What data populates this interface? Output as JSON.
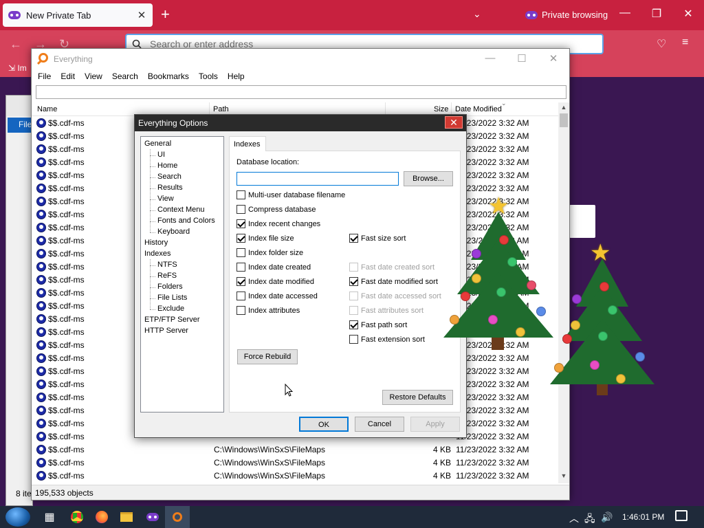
{
  "browser": {
    "tab_title": "New Private Tab",
    "tab_close": "✕",
    "new_tab": "+",
    "tab_list": "⌄",
    "private_label": "Private browsing",
    "url_placeholder": "Search or enter address",
    "import_label": "Im"
  },
  "bg_window": {
    "file_tab": "File",
    "status_text": "8 ite"
  },
  "everything": {
    "title": "Everything",
    "menu": [
      "File",
      "Edit",
      "View",
      "Search",
      "Bookmarks",
      "Tools",
      "Help"
    ],
    "columns": {
      "name": "Name",
      "path": "Path",
      "size": "Size",
      "date": "Date Modified"
    },
    "rows": [
      {
        "name": "$$.cdf-ms",
        "path": "",
        "size": "",
        "date": "11/23/2022 3:32 AM"
      },
      {
        "name": "$$.cdf-ms",
        "path": "",
        "size": "",
        "date": "11/23/2022 3:32 AM"
      },
      {
        "name": "$$.cdf-ms",
        "path": "",
        "size": "",
        "date": "11/23/2022 3:32 AM"
      },
      {
        "name": "$$.cdf-ms",
        "path": "",
        "size": "",
        "date": "11/23/2022 3:32 AM"
      },
      {
        "name": "$$.cdf-ms",
        "path": "",
        "size": "",
        "date": "11/23/2022 3:32 AM"
      },
      {
        "name": "$$.cdf-ms",
        "path": "",
        "size": "",
        "date": "11/23/2022 3:32 AM"
      },
      {
        "name": "$$.cdf-ms",
        "path": "",
        "size": "",
        "date": "11/23/2022 3:32 AM"
      },
      {
        "name": "$$.cdf-ms",
        "path": "",
        "size": "",
        "date": "11/23/2022 3:32 AM"
      },
      {
        "name": "$$.cdf-ms",
        "path": "",
        "size": "",
        "date": "11/23/2022 3:32 AM"
      },
      {
        "name": "$$.cdf-ms",
        "path": "",
        "size": "",
        "date": "11/23/2022 3:32 AM"
      },
      {
        "name": "$$.cdf-ms",
        "path": "",
        "size": "",
        "date": "11/23/2022 3:32 AM"
      },
      {
        "name": "$$.cdf-ms",
        "path": "",
        "size": "",
        "date": "11/23/2022 3:32 AM"
      },
      {
        "name": "$$.cdf-ms",
        "path": "",
        "size": "",
        "date": "11/23/2022 3:32 AM"
      },
      {
        "name": "$$.cdf-ms",
        "path": "",
        "size": "",
        "date": "11/23/2022 3:32 AM"
      },
      {
        "name": "$$.cdf-ms",
        "path": "",
        "size": "",
        "date": "11/23/2022 3:32 AM"
      },
      {
        "name": "$$.cdf-ms",
        "path": "",
        "size": "",
        "date": "11/23/2022 3:32 AM"
      },
      {
        "name": "$$.cdf-ms",
        "path": "",
        "size": "",
        "date": "11/23/2022 3:32 AM"
      },
      {
        "name": "$$.cdf-ms",
        "path": "",
        "size": "",
        "date": "11/23/2022 3:32 AM"
      },
      {
        "name": "$$.cdf-ms",
        "path": "",
        "size": "",
        "date": "11/23/2022 3:32 AM"
      },
      {
        "name": "$$.cdf-ms",
        "path": "",
        "size": "",
        "date": "11/23/2022 3:32 AM"
      },
      {
        "name": "$$.cdf-ms",
        "path": "",
        "size": "",
        "date": "11/23/2022 3:32 AM"
      },
      {
        "name": "$$.cdf-ms",
        "path": "",
        "size": "",
        "date": "11/23/2022 3:32 AM"
      },
      {
        "name": "$$.cdf-ms",
        "path": "",
        "size": "",
        "date": "11/23/2022 3:32 AM"
      },
      {
        "name": "$$.cdf-ms",
        "path": "",
        "size": "",
        "date": "11/23/2022 3:32 AM"
      },
      {
        "name": "$$.cdf-ms",
        "path": "",
        "size": "",
        "date": "11/23/2022 3:32 AM"
      },
      {
        "name": "$$.cdf-ms",
        "path": "C:\\Windows\\WinSxS\\FileMaps",
        "size": "4 KB",
        "date": "11/23/2022 3:32 AM"
      },
      {
        "name": "$$.cdf-ms",
        "path": "C:\\Windows\\WinSxS\\FileMaps",
        "size": "4 KB",
        "date": "11/23/2022 3:32 AM"
      },
      {
        "name": "$$.cdf-ms",
        "path": "C:\\Windows\\WinSxS\\FileMaps",
        "size": "4 KB",
        "date": "11/23/2022 3:32 AM"
      }
    ],
    "status": "195,533 objects"
  },
  "options": {
    "title": "Everything Options",
    "close": "✕",
    "tree": [
      {
        "label": "General",
        "level": 0
      },
      {
        "label": "UI",
        "level": 1
      },
      {
        "label": "Home",
        "level": 1
      },
      {
        "label": "Search",
        "level": 1
      },
      {
        "label": "Results",
        "level": 1
      },
      {
        "label": "View",
        "level": 1
      },
      {
        "label": "Context Menu",
        "level": 1
      },
      {
        "label": "Fonts and Colors",
        "level": 1
      },
      {
        "label": "Keyboard",
        "level": 1
      },
      {
        "label": "History",
        "level": 0
      },
      {
        "label": "Indexes",
        "level": 0
      },
      {
        "label": "NTFS",
        "level": 1
      },
      {
        "label": "ReFS",
        "level": 1
      },
      {
        "label": "Folders",
        "level": 1
      },
      {
        "label": "File Lists",
        "level": 1
      },
      {
        "label": "Exclude",
        "level": 1
      },
      {
        "label": "ETP/FTP Server",
        "level": 0
      },
      {
        "label": "HTTP Server",
        "level": 0
      }
    ],
    "tab": "Indexes",
    "db_label": "Database location:",
    "db_value": "",
    "browse": "Browse...",
    "left_checks": [
      {
        "label": "Multi-user database filename",
        "checked": false
      },
      {
        "label": "Compress database",
        "checked": false
      },
      {
        "label": "Index recent changes",
        "checked": true
      },
      {
        "label": "Index file size",
        "checked": true
      },
      {
        "label": "Index folder size",
        "checked": false
      },
      {
        "label": "Index date created",
        "checked": false
      },
      {
        "label": "Index date modified",
        "checked": true
      },
      {
        "label": "Index date accessed",
        "checked": false
      },
      {
        "label": "Index attributes",
        "checked": false
      }
    ],
    "right_checks": [
      {
        "label": "Fast size sort",
        "checked": true,
        "disabled": false
      },
      {
        "label": "",
        "checked": false,
        "disabled": false
      },
      {
        "label": "Fast date created sort",
        "checked": false,
        "disabled": true
      },
      {
        "label": "Fast date modified sort",
        "checked": true,
        "disabled": false
      },
      {
        "label": "Fast date accessed sort",
        "checked": false,
        "disabled": true
      },
      {
        "label": "Fast attributes sort",
        "checked": false,
        "disabled": true
      },
      {
        "label": "Fast path sort",
        "checked": true,
        "disabled": false
      },
      {
        "label": "Fast extension sort",
        "checked": false,
        "disabled": false
      }
    ],
    "force_rebuild": "Force Rebuild",
    "restore_defaults": "Restore Defaults",
    "ok": "OK",
    "cancel": "Cancel",
    "apply": "Apply"
  },
  "taskbar": {
    "clock": "1:46:01 PM"
  },
  "colors": {
    "firefox_titlebar": "#c8213f",
    "firefox_navbar": "#d6425b",
    "everything_accent": "#ef7d1a",
    "focus_blue": "#0078d7"
  },
  "icons": {
    "private_mask": "mask-icon",
    "search": "search-icon",
    "file": "cdf-file-icon",
    "start": "windows-orb-icon"
  }
}
